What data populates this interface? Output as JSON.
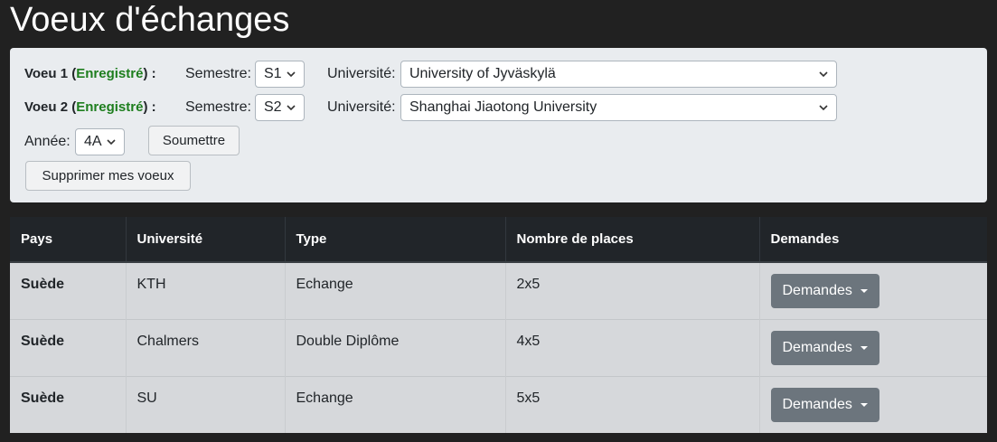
{
  "page": {
    "title": "Voeux d'échanges"
  },
  "form": {
    "voeu1": {
      "label": "Voeu 1",
      "status": "Enregistré",
      "semester_label": "Semestre:",
      "semester_value": "S1",
      "university_label": "Université:",
      "university_value": "University of Jyväskylä"
    },
    "voeu2": {
      "label": "Voeu 2",
      "status": "Enregistré",
      "semester_label": "Semestre:",
      "semester_value": "S2",
      "university_label": "Université:",
      "university_value": "Shanghai Jiaotong University"
    },
    "annee_label": "Année:",
    "annee_value": "4A",
    "submit_label": "Soumettre",
    "delete_label": "Supprimer mes voeux"
  },
  "table": {
    "headers": [
      "Pays",
      "Université",
      "Type",
      "Nombre de places",
      "Demandes"
    ],
    "rows": [
      {
        "pays": "Suède",
        "universite": "KTH",
        "type": "Echange",
        "places": "2x5",
        "demandes": "Demandes"
      },
      {
        "pays": "Suède",
        "universite": "Chalmers",
        "type": "Double Diplôme",
        "places": "4x5",
        "demandes": "Demandes"
      },
      {
        "pays": "Suède",
        "universite": "SU",
        "type": "Echange",
        "places": "5x5",
        "demandes": "Demandes"
      }
    ]
  },
  "colors": {
    "background": "#212121",
    "panel": "#e9ecef",
    "status_green": "#1e7e1e",
    "table_header": "#212529",
    "row_bg": "#d6d8db",
    "dropdown_button": "#6c757d"
  },
  "icons": {
    "select_arrow": "chevron-down-icon",
    "dropdown_caret": "caret-down-icon"
  }
}
